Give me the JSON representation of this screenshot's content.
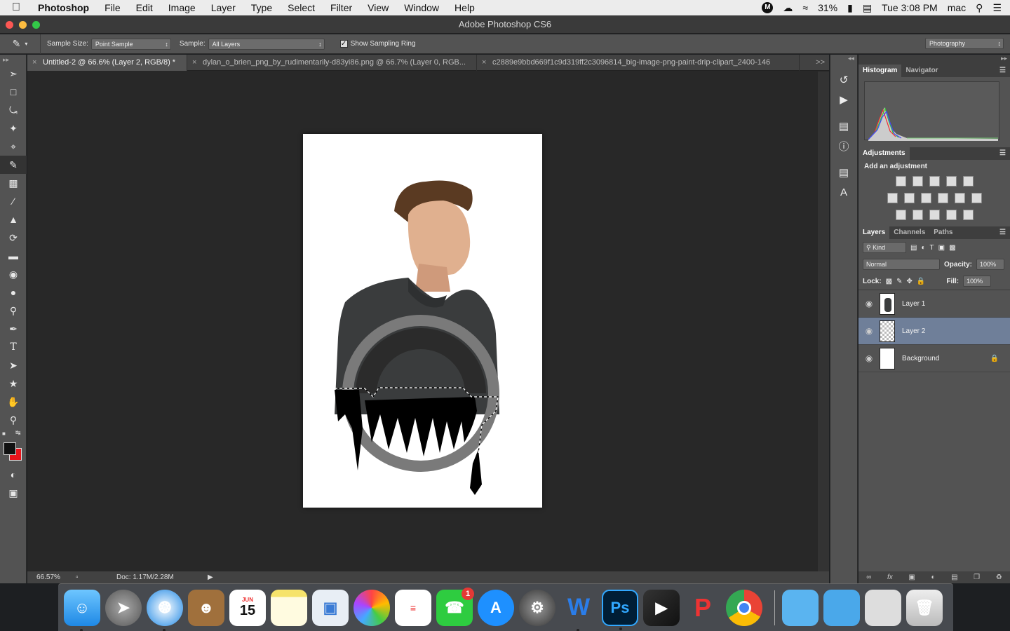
{
  "menubar": {
    "app_name": "Photoshop",
    "items": [
      "File",
      "Edit",
      "Image",
      "Layer",
      "Type",
      "Select",
      "Filter",
      "View",
      "Window",
      "Help"
    ],
    "battery": "31%",
    "clock": "Tue 3:08 PM",
    "user": "mac",
    "status_icon": "M"
  },
  "window": {
    "title": "Adobe Photoshop CS6"
  },
  "options_bar": {
    "sample_size_label": "Sample Size:",
    "sample_size_value": "Point Sample",
    "sample_label": "Sample:",
    "sample_value": "All Layers",
    "show_ring_label": "Show Sampling Ring",
    "show_ring_checked": true,
    "workspace": "Photography"
  },
  "tabs": [
    {
      "label": "Untitled-2 @ 66.6% (Layer 2, RGB/8) *",
      "active": true
    },
    {
      "label": "dylan_o_brien_png_by_rudimentarily-d83yi86.png @ 66.7% (Layer 0, RGB...",
      "active": false
    },
    {
      "label": "c2889e9bbd669f1c9d319ff2c3096814_big-image-png-paint-drip-clipart_2400-146",
      "active": false
    }
  ],
  "tabs_overflow": ">>",
  "status": {
    "zoom": "66.57%",
    "doc": "Doc: 1.17M/2.28M"
  },
  "panels": {
    "histogram_tabs": [
      "Histogram",
      "Navigator"
    ],
    "adjustments_tab": "Adjustments",
    "adjustments_title": "Add an adjustment",
    "layer_tabs": [
      "Layers",
      "Channels",
      "Paths"
    ],
    "kind_filter": "Kind",
    "blend_mode": "Normal",
    "opacity_label": "Opacity:",
    "opacity": "100%",
    "lock_label": "Lock:",
    "fill_label": "Fill:",
    "fill": "100%",
    "layers": [
      {
        "name": "Layer 1",
        "selected": false,
        "thumb": "photo"
      },
      {
        "name": "Layer 2",
        "selected": true,
        "thumb": "checker"
      },
      {
        "name": "Background",
        "selected": false,
        "thumb": "white",
        "locked": true
      }
    ]
  },
  "dock": {
    "calendar_month": "JUN",
    "calendar_day": "15",
    "facetime_badge": "1",
    "apps": [
      "finder-icon",
      "launchpad-icon",
      "safari-icon",
      "contacts-icon",
      "calendar-icon",
      "notes-icon",
      "preview-icon",
      "photos-icon",
      "reminders-icon",
      "facetime-icon",
      "app-store-icon",
      "system-preferences-icon",
      "word-icon",
      "photoshop-icon",
      "final-cut-icon",
      "pages-icon",
      "chrome-icon"
    ]
  },
  "colors": {
    "foreground": "#111111",
    "background": "#e8141b",
    "selection_row": "#6f7f99",
    "ring_outer": "#7a7a7a",
    "ring_inner": "#2b2b2b"
  }
}
